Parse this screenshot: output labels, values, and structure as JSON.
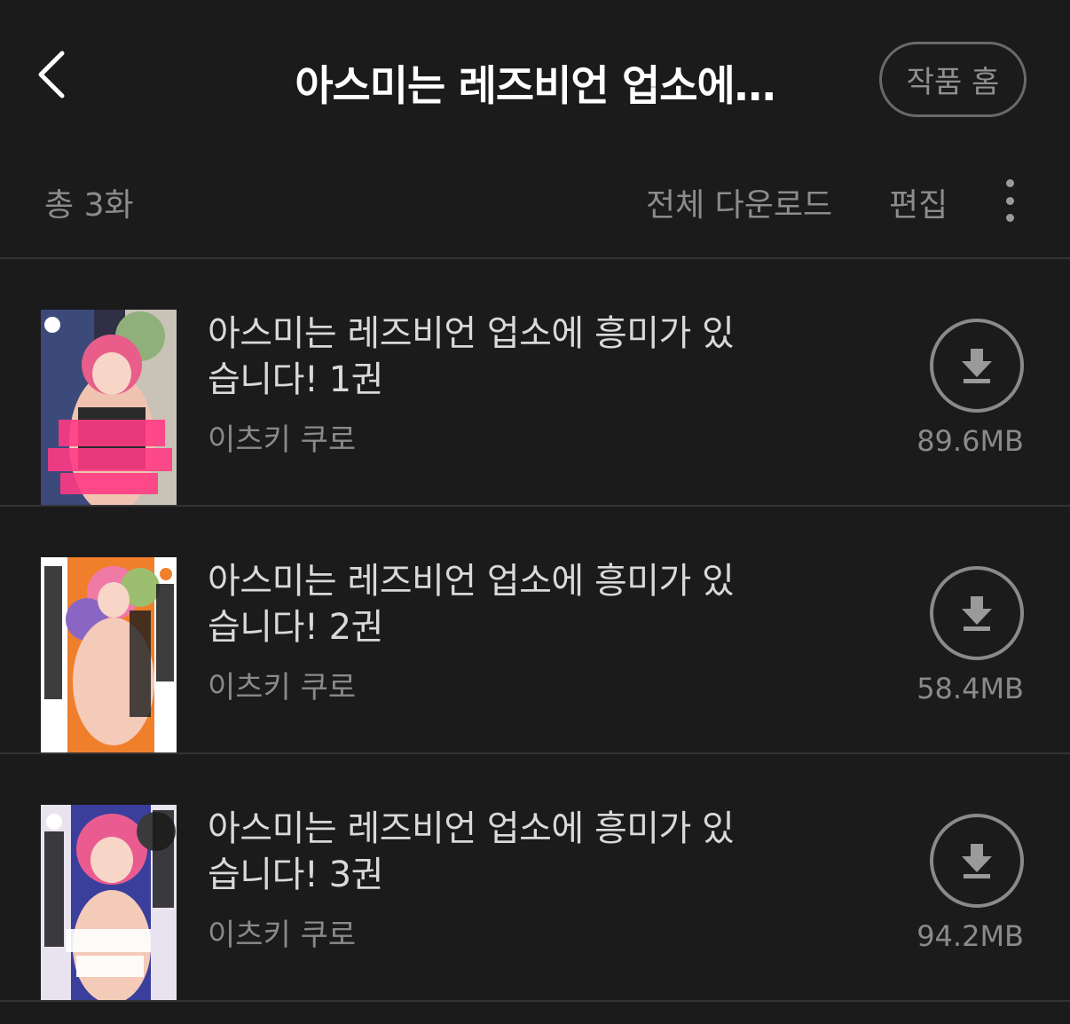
{
  "header": {
    "title": "아스미는 레즈비언 업소에…",
    "home_label": "작품 홈",
    "back_icon": "chevron-left-icon"
  },
  "toolbar": {
    "total": "총 3화",
    "download_all": "전체 다운로드",
    "edit": "편집",
    "more_icon": "more-vertical-icon"
  },
  "items": [
    {
      "title": "아스미는 레즈비언 업소에 흥미가 있습니다! 1권",
      "author": "이츠키 쿠로",
      "size": "89.6MB",
      "cover_colors": [
        "#e74b8a",
        "#3b3b5a",
        "#f3c7b6"
      ]
    },
    {
      "title": "아스미는 레즈비언 업소에 흥미가 있습니다! 2권",
      "author": "이츠키 쿠로",
      "size": "58.4MB",
      "cover_colors": [
        "#ef7b2d",
        "#7a5bbd",
        "#f3c7b6"
      ]
    },
    {
      "title": "아스미는 레즈비언 업소에 흥미가 있습니다! 3권",
      "author": "이츠키 쿠로",
      "size": "94.2MB",
      "cover_colors": [
        "#3a3f9c",
        "#ea5c8f",
        "#f3c7b6"
      ]
    }
  ]
}
